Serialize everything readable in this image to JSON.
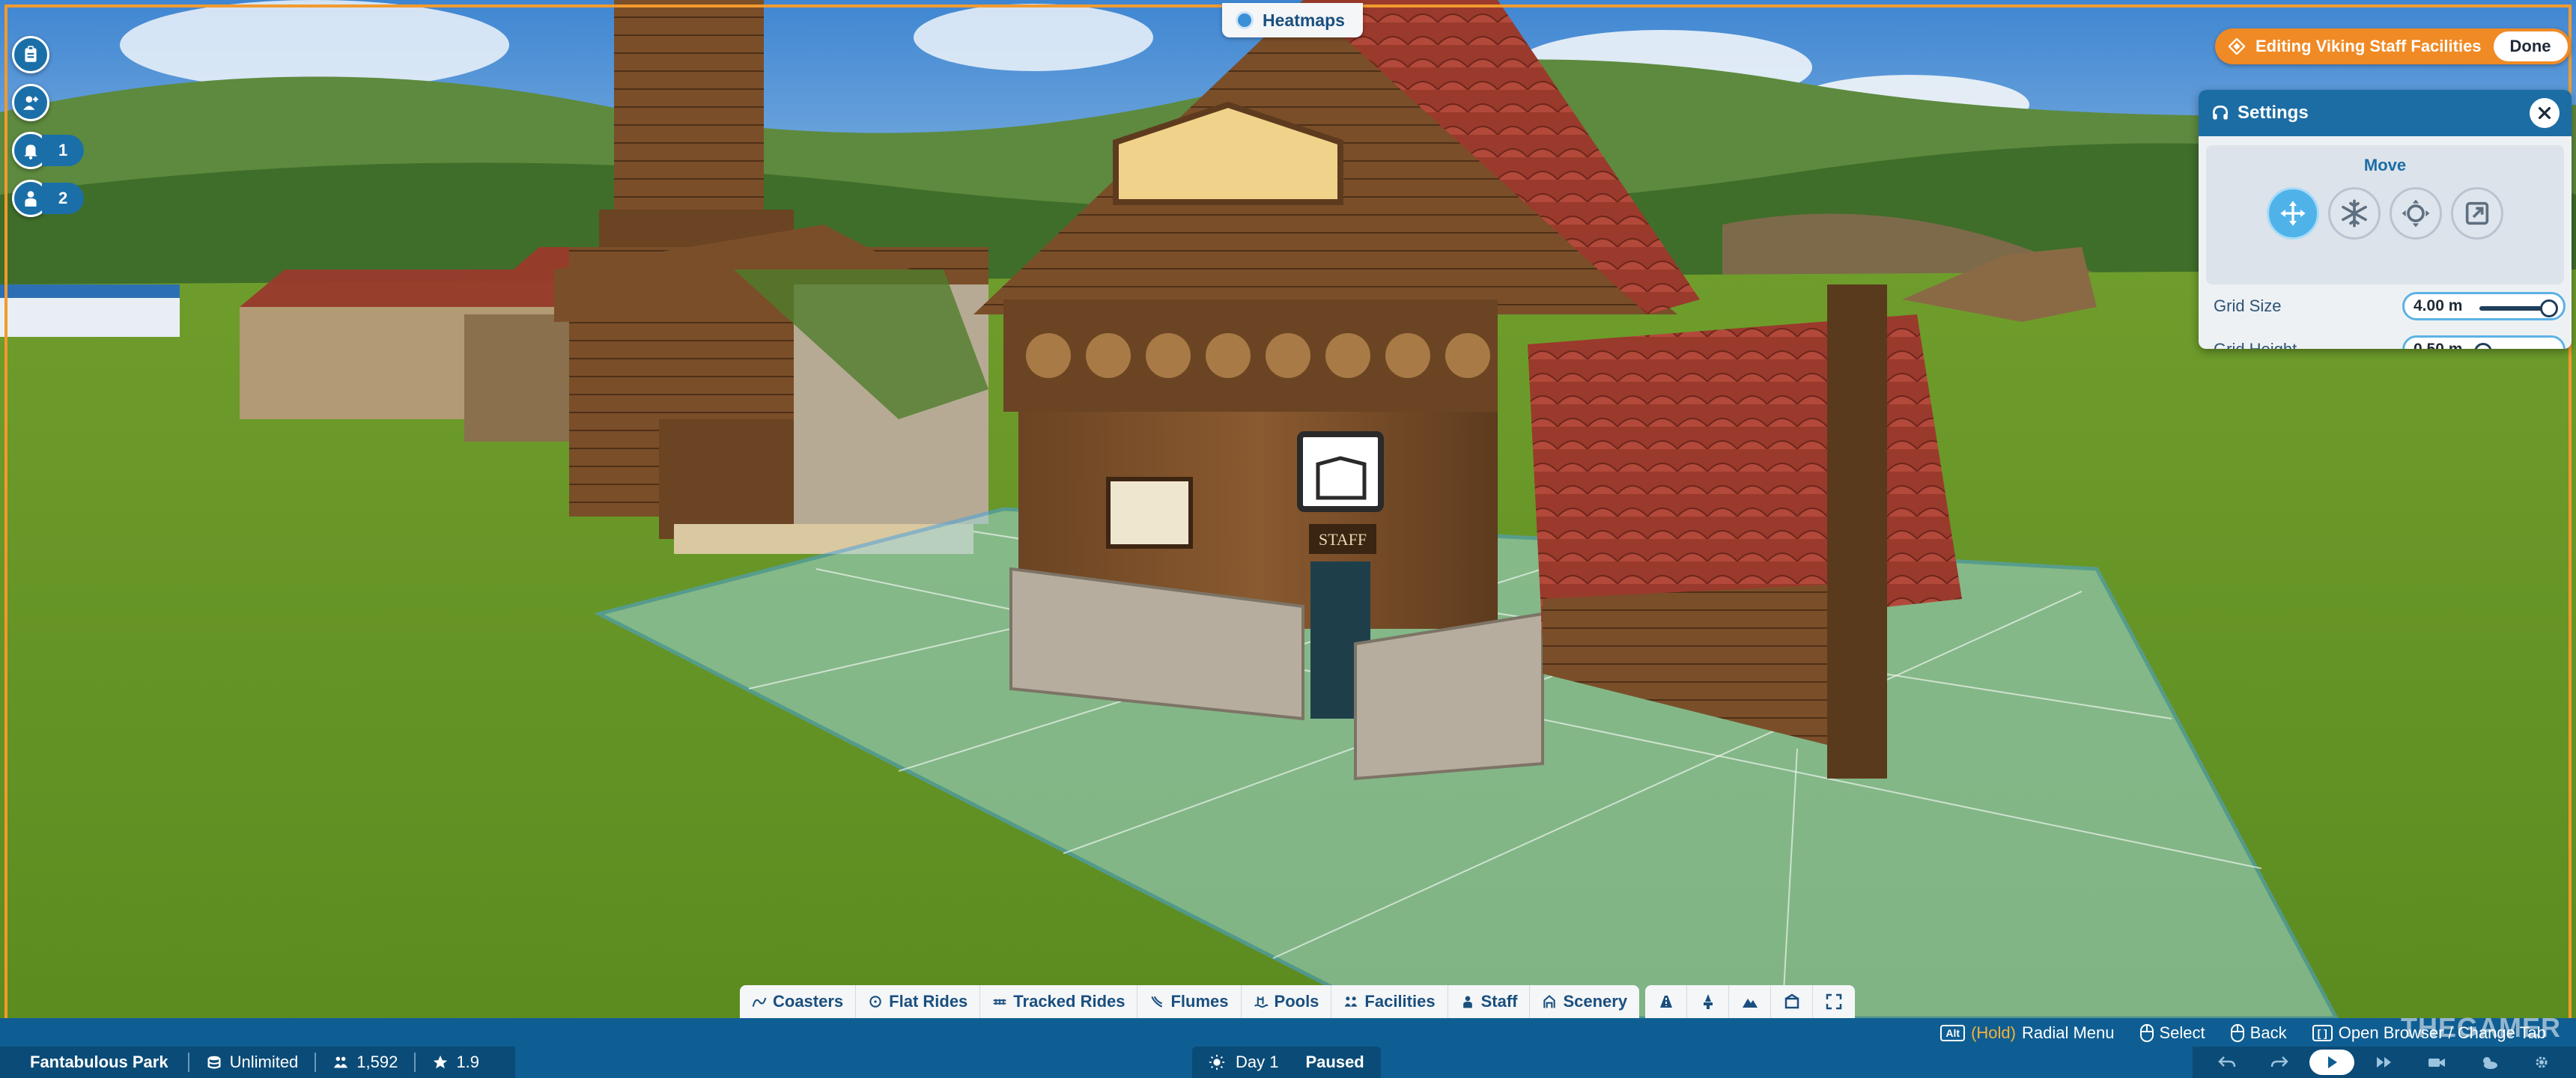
{
  "top": {
    "heatmaps_label": "Heatmaps"
  },
  "left_toolbar": [
    {
      "icon": "clipboard-icon",
      "count": ""
    },
    {
      "icon": "add-guest-icon",
      "count": ""
    },
    {
      "icon": "notification-bell-icon",
      "count": "1"
    },
    {
      "icon": "staff-person-icon",
      "count": "2"
    }
  ],
  "editing": {
    "title": "Editing Viking Staff Facilities",
    "done_label": "Done"
  },
  "settings": {
    "title": "Settings",
    "move_label": "Move",
    "tools": [
      {
        "icon": "move-arrows-icon",
        "active": true
      },
      {
        "icon": "freeze-snowflake-icon",
        "active": false
      },
      {
        "icon": "rotate-move-icon",
        "active": false
      },
      {
        "icon": "scale-icon",
        "active": false
      }
    ],
    "grid_size": {
      "label": "Grid Size",
      "value": "4.00 m",
      "level": 0.95
    },
    "grid_height": {
      "label": "Grid Height",
      "value": "0.50 m",
      "level": 0.05
    }
  },
  "scene": {
    "sign_text": "STAFF"
  },
  "categories": [
    {
      "label": "Coasters",
      "icon": "coaster-icon"
    },
    {
      "label": "Flat Rides",
      "icon": "flat-ride-icon"
    },
    {
      "label": "Tracked Rides",
      "icon": "tracked-ride-icon"
    },
    {
      "label": "Flumes",
      "icon": "flume-icon"
    },
    {
      "label": "Pools",
      "icon": "pool-icon"
    },
    {
      "label": "Facilities",
      "icon": "facilities-icon"
    },
    {
      "label": "Staff",
      "icon": "staff-icon"
    },
    {
      "label": "Scenery",
      "icon": "scenery-icon"
    }
  ],
  "category_tools": [
    "path-icon",
    "terrain-paint-icon",
    "terrain-icon",
    "blueprint-icon",
    "expand-icon"
  ],
  "hints": {
    "radial_key": "Alt",
    "radial_hold": "(Hold)",
    "radial_label": "Radial Menu",
    "select_label": "Select",
    "back_label": "Back",
    "browser_key": "[ ]",
    "browser_label": "Open Browser / Change Tab"
  },
  "status": {
    "park_name": "Fantabulous Park",
    "money": "Unlimited",
    "guests": "1,592",
    "rating": "1.9",
    "day": "Day 1",
    "paused": "Paused"
  },
  "watermark": "THEGAMER",
  "colors": {
    "accent": "#f08a24",
    "panel_blue": "#1c6da4",
    "bar_blue": "#0f5e93"
  }
}
